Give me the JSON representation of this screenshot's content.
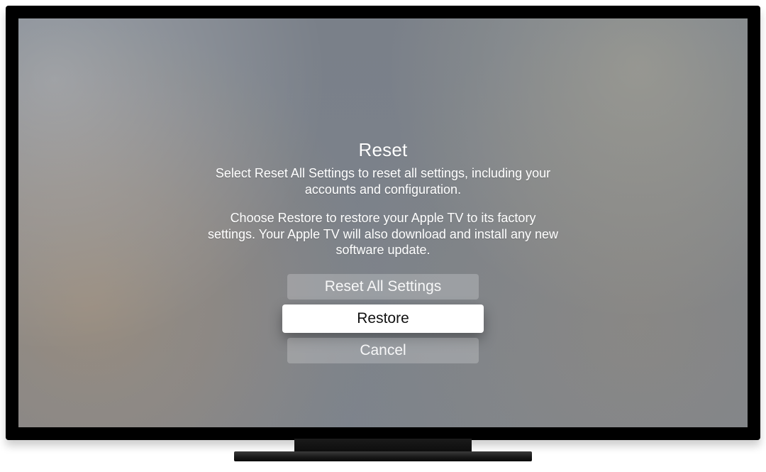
{
  "dialog": {
    "title": "Reset",
    "paragraph1": "Select Reset All Settings to reset all settings, including your accounts and configuration.",
    "paragraph2": "Choose Restore to restore your Apple TV to its factory settings. Your Apple TV will also download and install any new software update.",
    "buttons": {
      "reset_all": "Reset All Settings",
      "restore": "Restore",
      "cancel": "Cancel"
    },
    "focused": "restore"
  }
}
